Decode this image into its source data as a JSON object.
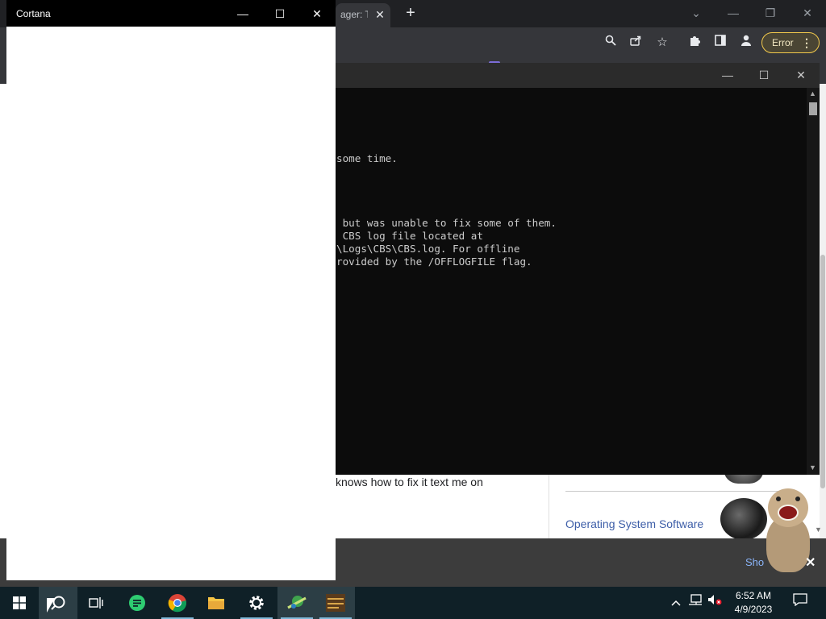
{
  "browser": {
    "tab_title_fragment": "ager: Th",
    "tab_close": "✕",
    "new_tab": "+",
    "error_button": "Error",
    "menu_dots": "⋮",
    "page": {
      "post_text": "knows how to fix it text me on",
      "sidebar_link": "Operating System Software",
      "bottom_bar_link": "Sho",
      "bottom_bar_close": "✕"
    }
  },
  "terminal": {
    "lines": [
      "some time.",
      " but was unable to fix some of them.",
      " CBS log file located at",
      "\\Logs\\CBS\\CBS.log. For offline",
      "rovided by the /OFFLOGFILE flag."
    ]
  },
  "cortana": {
    "title": "Cortana"
  },
  "taskbar": {
    "clock_time": "6:52 AM",
    "clock_date": "4/9/2023",
    "pinned": [
      "start",
      "search",
      "task-view",
      "notes",
      "chrome",
      "file-explorer",
      "settings",
      "app",
      "app2"
    ]
  },
  "colors": {
    "chrome_dark": "#202124",
    "terminal_bg": "#0c0c0c",
    "taskbar_bg": "#0f2027",
    "link_blue": "#3d5ea8",
    "error_border": "#f2c94c"
  }
}
